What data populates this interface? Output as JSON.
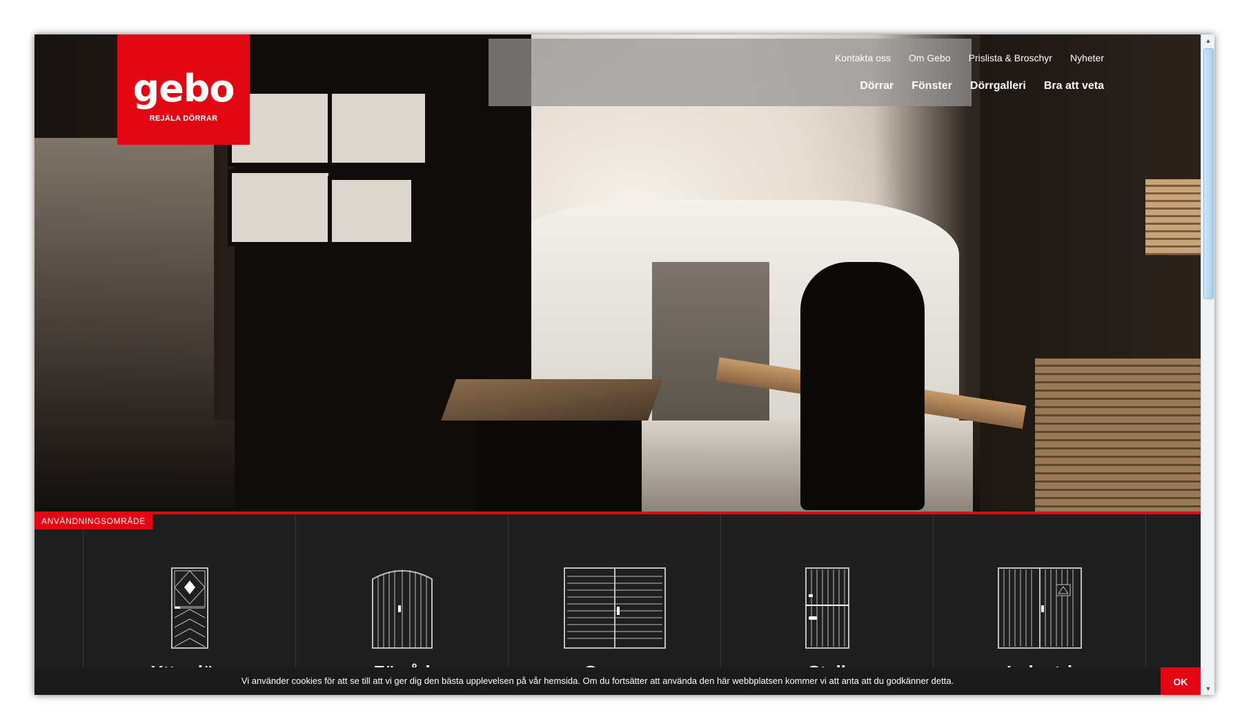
{
  "brand": {
    "logo_text": "gebo",
    "tagline": "REJÄLA DÖRRAR",
    "accent_color": "#e30613"
  },
  "nav": {
    "top": [
      "Kontakta oss",
      "Om Gebo",
      "Prislista & Broschyr",
      "Nyheter"
    ],
    "main": [
      "Dörrar",
      "Fönster",
      "Dörrgalleri",
      "Bra att veta"
    ]
  },
  "usage": {
    "tab_label": "ANVÄNDNINGSOMRÅDE",
    "items": [
      {
        "icon": "front-door-icon",
        "label": "Ytterdörr"
      },
      {
        "icon": "storage-door-icon",
        "label": "Förråd"
      },
      {
        "icon": "garage-door-icon",
        "label": "Garage"
      },
      {
        "icon": "stable-door-icon",
        "label": "Stall"
      },
      {
        "icon": "industrial-door-icon",
        "label": "Industri"
      }
    ]
  },
  "cookie": {
    "message": "Vi använder cookies för att se till att vi ger dig den bästa upplevelsen på vår hemsida. Om du fortsätter att använda den här webbplatsen kommer vi att anta att du godkänner detta.",
    "ok_label": "OK"
  }
}
